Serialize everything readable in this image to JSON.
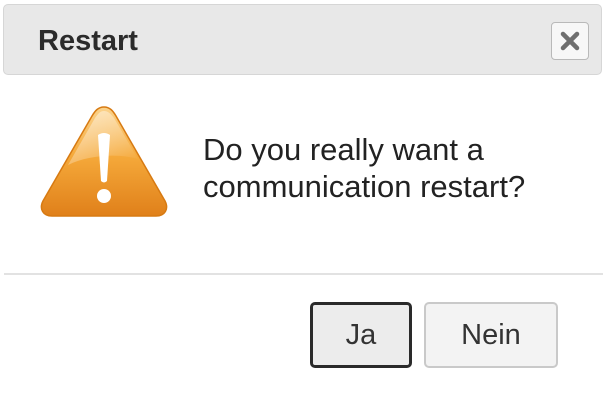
{
  "dialog": {
    "title": "Restart",
    "close_icon": "close-icon",
    "warning_icon": "warning-triangle-icon",
    "message_line1": "Do you really want a",
    "message_line2": "communication restart?",
    "yes_label": "Ja",
    "no_label": "Nein"
  },
  "colors": {
    "titlebar_bg": "#e8e8e8",
    "warning_orange": "#f0951c",
    "warning_light": "#f9c777"
  }
}
